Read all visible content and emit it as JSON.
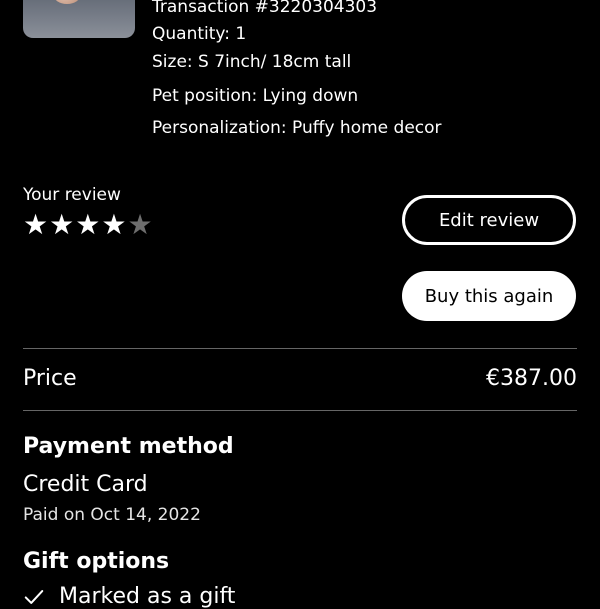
{
  "product": {
    "transaction": "Transaction #3220304303",
    "quantity": "Quantity: 1",
    "size": "Size: S 7inch/ 18cm tall",
    "pet_position": "Pet position: Lying down",
    "personalization": "Personalization: Puffy home decor"
  },
  "review": {
    "label": "Your review",
    "rating": 4,
    "max_rating": 5,
    "edit_button": "Edit review",
    "buy_again_button": "Buy this again"
  },
  "price": {
    "label": "Price",
    "value": "€387.00"
  },
  "payment": {
    "title": "Payment method",
    "method": "Credit Card",
    "paid_on": "Paid on Oct 14, 2022"
  },
  "gift": {
    "title": "Gift options",
    "marked": "Marked as a gift"
  }
}
